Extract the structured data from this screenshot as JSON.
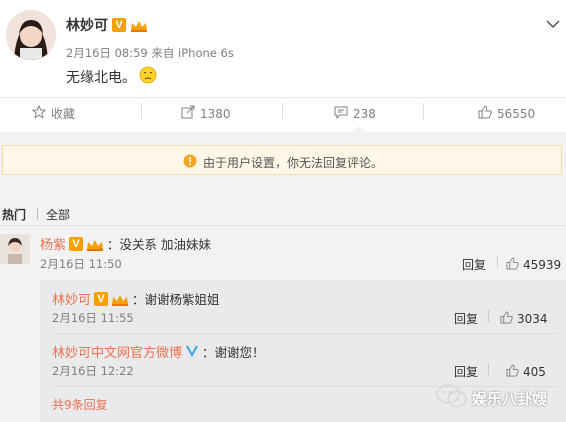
{
  "post": {
    "author": "林妙可",
    "meta": "2月16日 08:59 来自 iPhone 6s",
    "text": "无缘北电。"
  },
  "actions": {
    "favorite": "收藏",
    "forward": "1380",
    "comment": "238",
    "like": "56550"
  },
  "notice": "由于用户设置，你无法回复评论。",
  "tabs": {
    "hot": "热门",
    "all": "全部"
  },
  "comments": [
    {
      "author": "杨紫",
      "text": "：没关系 加油妹妹",
      "time": "2月16日 11:50",
      "reply": "回复",
      "likes": "45939"
    }
  ],
  "replies": [
    {
      "author": "林妙可",
      "text": "：谢谢杨紫姐姐",
      "time": "2月16日 11:55",
      "reply": "回复",
      "likes": "3034"
    },
    {
      "author": "林妙可中文网官方微博",
      "text": "：谢谢您！",
      "time": "2月16日 12:22",
      "reply": "回复",
      "likes": "405"
    }
  ],
  "more_replies": "共9条回复",
  "watermark": "娱乐八卦嫂",
  "colors": {
    "name": "#eb7350",
    "vip": "#f6a000",
    "verified": "#4aa6e8"
  }
}
